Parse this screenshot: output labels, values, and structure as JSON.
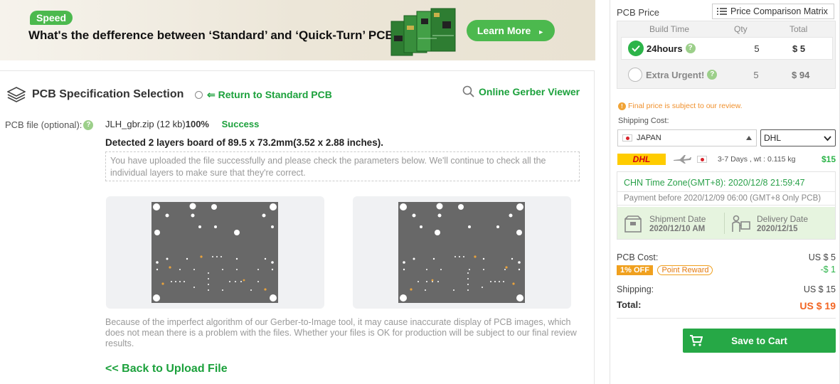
{
  "banner": {
    "tag": "Speed",
    "title": "What's the defference between ‘Standard’ and ‘Quick-Turn’ PCB",
    "learn_more": "Learn More"
  },
  "spec": {
    "title": "PCB Specification Selection",
    "return_link": "⇐ Return to Standard PCB",
    "gerber_viewer": "Online Gerber Viewer",
    "pcb_file_label": "PCB file (optional):",
    "help_mark": "?",
    "file_name": "JLH_gbr.zip (12 kb)",
    "file_progress": "100%",
    "file_status": "Success",
    "detected": "Detected 2 layers board of 89.5 x 73.2mm(3.52 x 2.88 inches).",
    "notice": "You have uploaded the file successfully and please check the parameters below. We'll continue to check all the individual layers to make sure that they're correct.",
    "disclaimer": "Because of the imperfect algorithm of our Gerber-to-Image tool, it may cause inaccurate display of PCB images, which does not mean there is a problem with the files. Whether your files is OK for production will be subject to our final review results.",
    "back_link": "<< Back to Upload File"
  },
  "sidebar": {
    "pcb_price": "PCB Price",
    "matrix_btn": "Price Comparison Matrix",
    "headers": {
      "build_time": "Build Time",
      "qty": "Qty",
      "total": "Total"
    },
    "options": [
      {
        "build_time": "24hours",
        "qty": "5",
        "total": "$ 5",
        "selected": true
      },
      {
        "build_time": "Extra Urgent!",
        "qty": "5",
        "total": "$ 94",
        "selected": false
      }
    ],
    "final_note": "Final price is subject to our review.",
    "shipping_cost_label": "Shipping Cost:",
    "country": "JAPAN",
    "courier": "DHL",
    "courier_logo": "DHL",
    "ship_days": "3-7 Days ,   wt : 0.115 kg",
    "ship_price": "$15",
    "timezone": "CHN Time Zone(GMT+8): 2020/12/8 21:59:47",
    "pay_before": "Payment before 2020/12/09 06:00 (GMT+8 Only PCB)",
    "shipment_label": "Shipment Date",
    "shipment_date": "2020/12/10 AM",
    "delivery_label": "Delivery Date",
    "delivery_date": "2020/12/15",
    "pcb_cost_label": "PCB Cost:",
    "pcb_cost": "US $ 5",
    "off_tag": "1% OFF",
    "reward_tag": "Point Reward",
    "discount": "-$ 1",
    "shipping_label": "Shipping:",
    "shipping": "US $ 15",
    "total_label": "Total:",
    "total": "US $ 19",
    "cart_btn": "Save to Cart"
  },
  "colors": {
    "accent_green": "#26a846",
    "link_green": "#1ca13c",
    "orange": "#f26522"
  }
}
